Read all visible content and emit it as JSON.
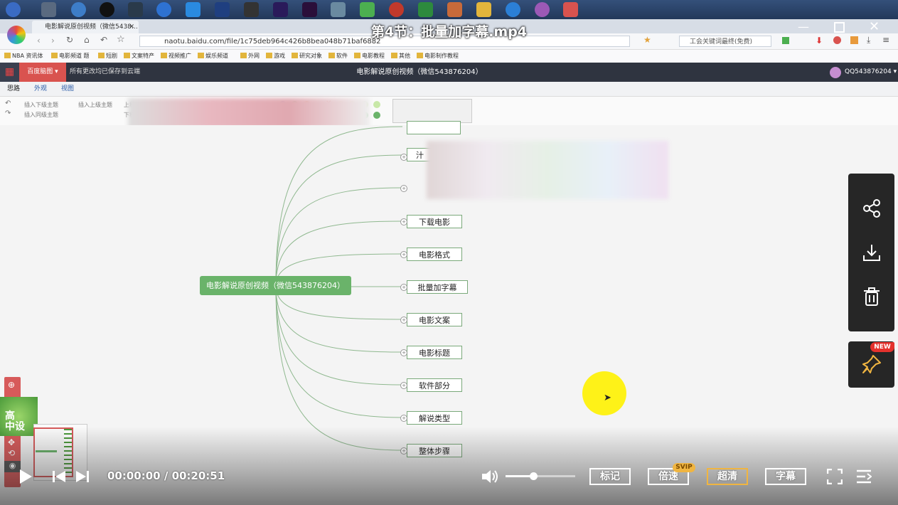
{
  "video": {
    "title": "第4节：批量加字幕.mp4"
  },
  "browser": {
    "tab_title": "电影解说原创视频（微信5438…",
    "url": "naotu.baidu.com/file/1c75deb964c426b8bea048b71baf6882",
    "search_text": "工会关键词最终(免费)"
  },
  "bookmarks": [
    "NBA 资讯体",
    "电影频道 题",
    "短剧",
    "文案特产",
    "视频推广",
    "娱乐频道",
    "外网",
    "游戏",
    "研究对象",
    "软件",
    "电影教程",
    "其他",
    "电影制作教程"
  ],
  "app": {
    "menu_label": "百度脑图",
    "save_status": "所有更改均已保存到云端",
    "doc_title": "电影解说原创视频（微信543876204）",
    "user": "QQ543876204",
    "ribbon_tabs": [
      "思路",
      "外观",
      "视图"
    ],
    "ribbon_actions": [
      "插入下级主题",
      "插入上级主题",
      "插入同级主题",
      "上移",
      "下移"
    ]
  },
  "mindmap": {
    "root": "电影解说原创视频（微信543876204）",
    "children": [
      "下载电影",
      "电影格式",
      "批量加字幕",
      "电影文案",
      "电影标题",
      "软件部分",
      "解说类型",
      "整体步骤"
    ],
    "partial_children": [
      "汁"
    ]
  },
  "watermark": {
    "text_line1": "高",
    "text_line2": "中设"
  },
  "side_panel": {
    "badge": "NEW",
    "icons": [
      "share-icon",
      "download-icon",
      "trash-icon",
      "pin-icon"
    ]
  },
  "player": {
    "current_time": "00:00:00",
    "duration": "00:20:51",
    "volume_fraction": 0.4,
    "buttons": {
      "mark": "标记",
      "speed": "倍速",
      "quality": "超清",
      "subtitle": "字幕"
    },
    "svip_badge": "SVIP"
  },
  "colors": {
    "accent_red": "#d9534f",
    "node_green": "#6ab36a",
    "highlight": "#fff200"
  }
}
